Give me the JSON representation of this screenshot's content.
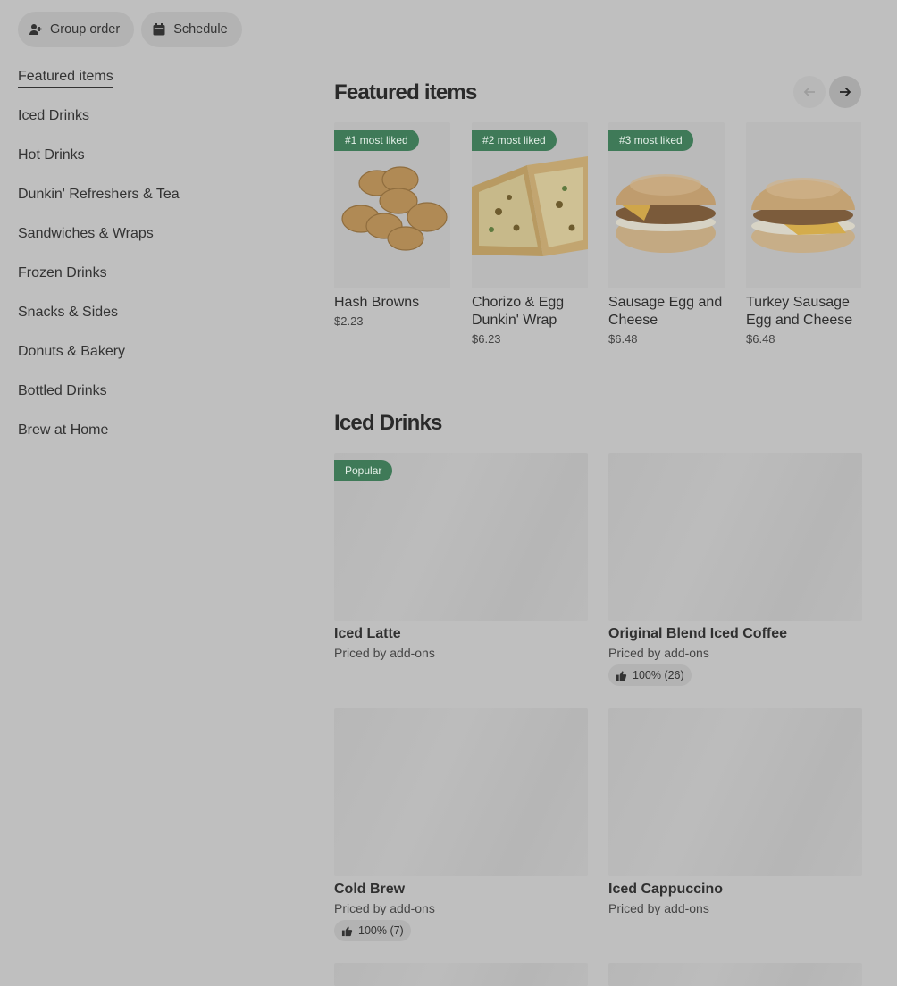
{
  "toolbar": {
    "group_order_label": "Group order",
    "schedule_label": "Schedule"
  },
  "sidebar": {
    "items": [
      {
        "label": "Featured items"
      },
      {
        "label": "Iced Drinks"
      },
      {
        "label": "Hot Drinks"
      },
      {
        "label": "Dunkin' Refreshers & Tea"
      },
      {
        "label": "Sandwiches & Wraps"
      },
      {
        "label": "Frozen Drinks"
      },
      {
        "label": "Snacks & Sides"
      },
      {
        "label": "Donuts & Bakery"
      },
      {
        "label": "Bottled Drinks"
      },
      {
        "label": "Brew at Home"
      }
    ]
  },
  "featured": {
    "title": "Featured items",
    "items": [
      {
        "badge": "#1 most liked",
        "name": "Hash Browns",
        "price": "$2.23",
        "image": "hash-browns"
      },
      {
        "badge": "#2 most liked",
        "name": "Chorizo & Egg Dunkin' Wrap",
        "price": "$6.23",
        "image": "wrap"
      },
      {
        "badge": "#3 most liked",
        "name": "Sausage Egg and Cheese",
        "price": "$6.48",
        "image": "sandwich"
      },
      {
        "name": "Turkey Sausage Egg and Cheese",
        "price": "$6.48",
        "image": "sandwich"
      }
    ]
  },
  "iced": {
    "title": "Iced Drinks",
    "items": [
      {
        "badge": "Popular",
        "name": "Iced Latte",
        "sub": "Priced by add-ons"
      },
      {
        "name": "Original Blend Iced Coffee",
        "sub": "Priced by add-ons",
        "rating": "100% (26)"
      },
      {
        "name": "Cold Brew",
        "sub": "Priced by add-ons",
        "rating": "100% (7)"
      },
      {
        "name": "Iced Cappuccino",
        "sub": "Priced by add-ons"
      }
    ]
  },
  "colors": {
    "badge_bg": "#3f7a58",
    "overlay": "#bfbfbf"
  }
}
